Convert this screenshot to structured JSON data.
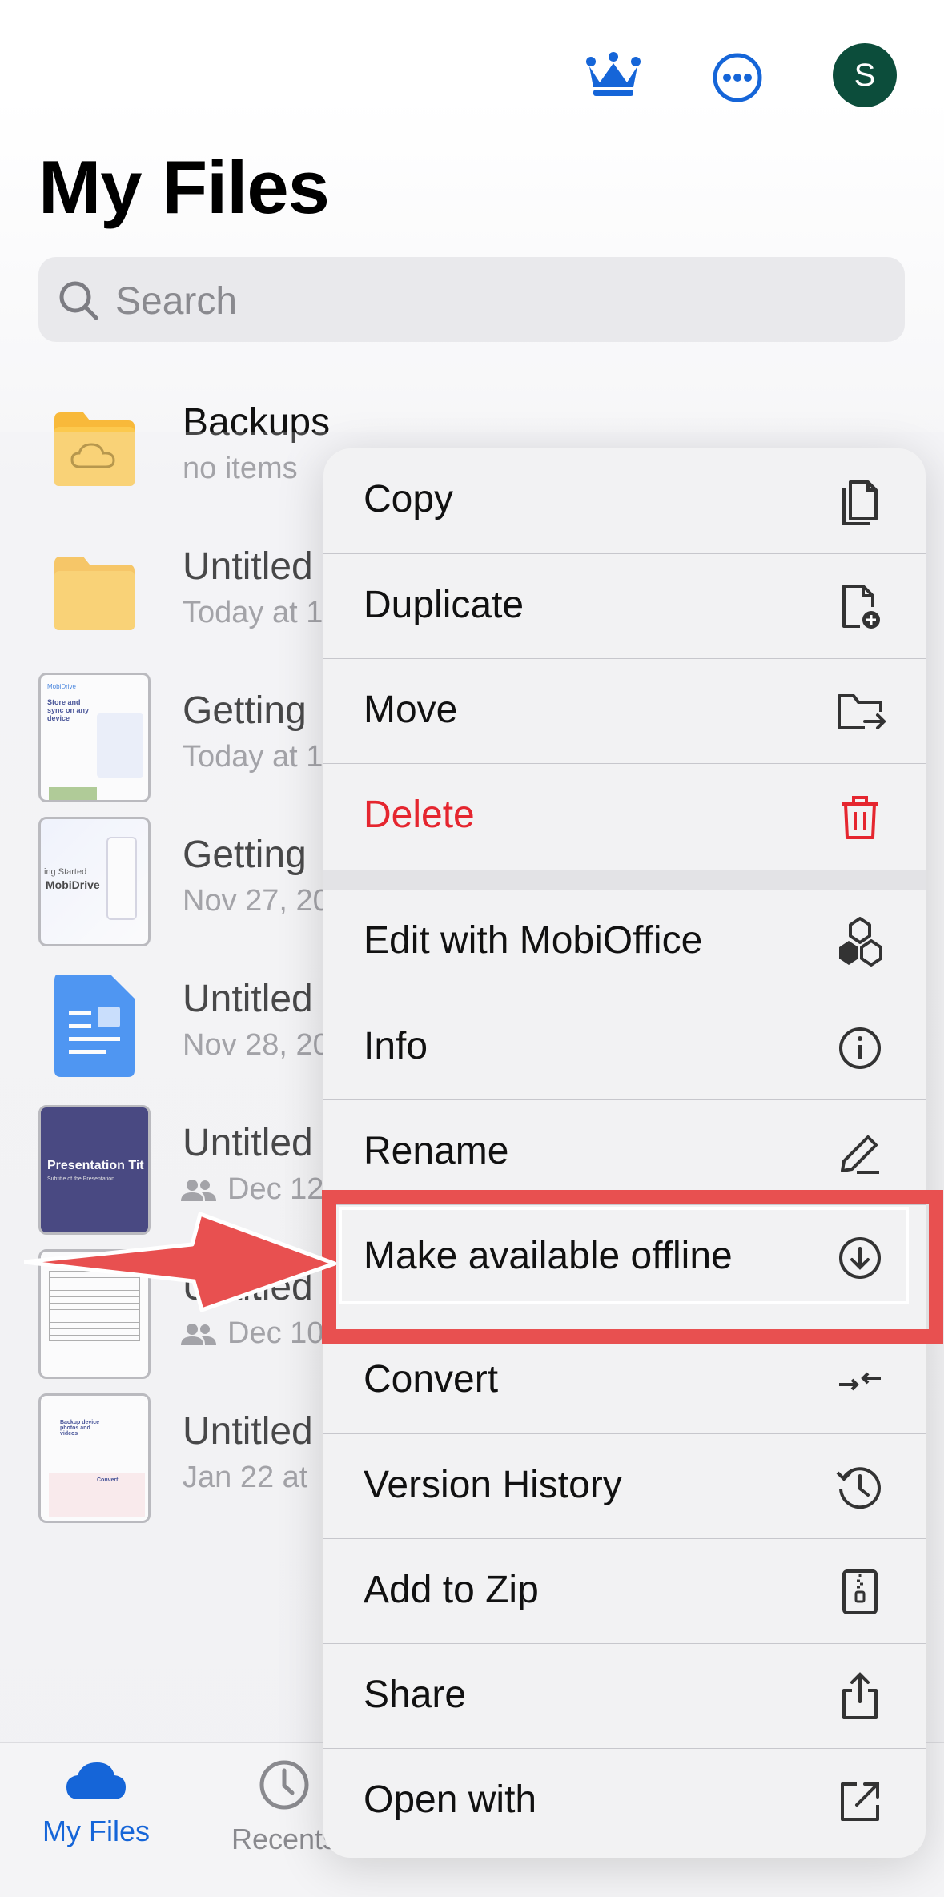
{
  "header": {
    "title": "My Files",
    "avatar_initial": "S"
  },
  "search": {
    "placeholder": "Search"
  },
  "files": [
    {
      "name": "Backups",
      "sub": "no items"
    },
    {
      "name": "Untitled",
      "sub": "Today at 1"
    },
    {
      "name": "Getting",
      "sub": "Today at 1"
    },
    {
      "name": "Getting",
      "sub": "Nov 27, 20"
    },
    {
      "name": "Untitled",
      "sub": "Nov 28, 20"
    },
    {
      "name": "Untitled",
      "sub": "Dec 12"
    },
    {
      "name": "Untitled",
      "sub": "Dec 10"
    },
    {
      "name": "Untitled",
      "sub": "Jan 22 at"
    }
  ],
  "thumbnails": {
    "mobidrive": "MobiDrive",
    "store_sync": "Store and sync on any device",
    "getting_started": "ing Started",
    "presentation_title": "Presentation Tit",
    "presentation_subtitle": "Subtitle of the Presentation",
    "backup": "Backup device photos and videos",
    "convert": "Convert"
  },
  "menu": {
    "items": [
      {
        "label": "Copy",
        "icon": "copy-icon"
      },
      {
        "label": "Duplicate",
        "icon": "duplicate-icon"
      },
      {
        "label": "Move",
        "icon": "move-icon"
      },
      {
        "label": "Delete",
        "icon": "trash-icon"
      },
      {
        "label": "Edit with MobiOffice",
        "icon": "mobioffice-icon"
      },
      {
        "label": "Info",
        "icon": "info-icon"
      },
      {
        "label": "Rename",
        "icon": "pencil-icon"
      },
      {
        "label": "Make available offline",
        "icon": "download-circle-icon"
      },
      {
        "label": "Convert",
        "icon": "convert-icon"
      },
      {
        "label": "Version History",
        "icon": "history-icon"
      },
      {
        "label": "Add to Zip",
        "icon": "zip-icon"
      },
      {
        "label": "Share",
        "icon": "share-icon"
      },
      {
        "label": "Open with",
        "icon": "open-with-icon"
      }
    ]
  },
  "tabbar": {
    "my_files": "My Files",
    "recents": "Recents"
  },
  "colors": {
    "accent": "#1565d8",
    "delete": "#e5262f",
    "highlight": "#e85050",
    "avatar": "#0c4d3b",
    "folder": "#fcc94e"
  }
}
